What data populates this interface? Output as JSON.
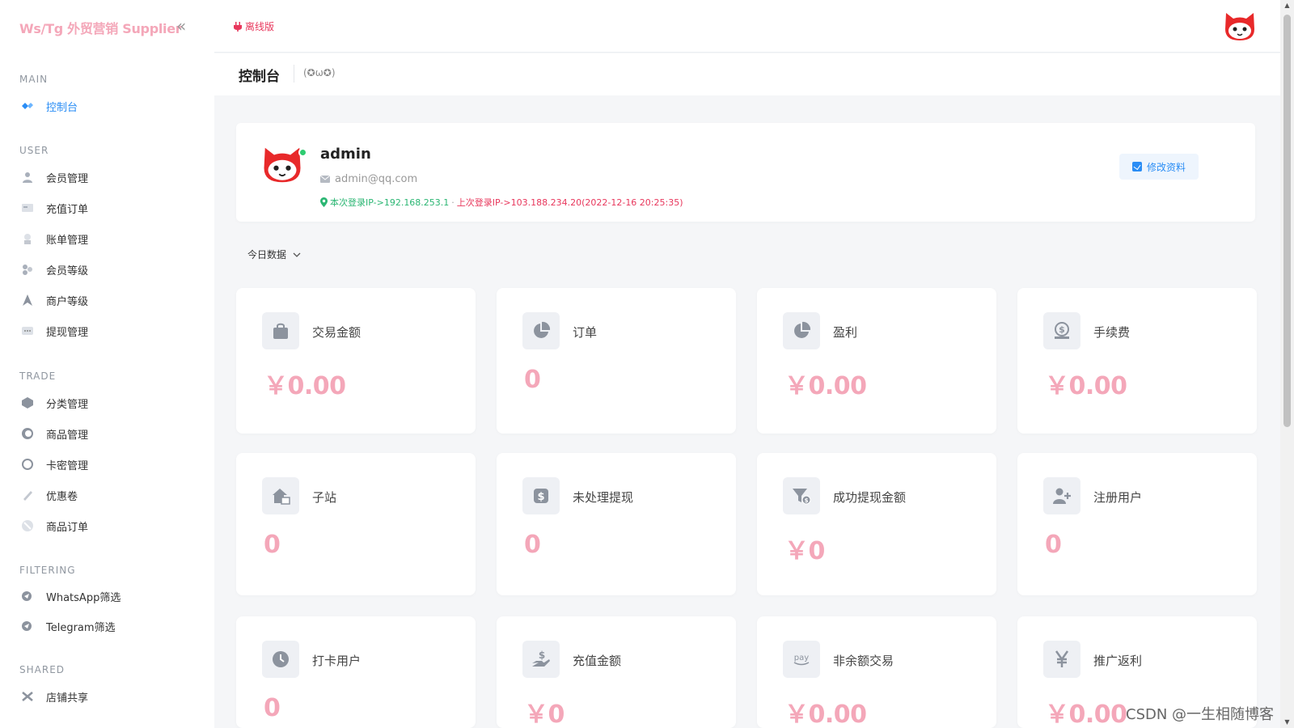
{
  "app": {
    "brand": "Ws/Tg 外贸营销 Supplier",
    "offline_label": "离线版"
  },
  "sidebar": {
    "sections": [
      {
        "title": "MAIN",
        "items": [
          {
            "label": "控制台",
            "icon": "dashboard-icon",
            "active": true
          }
        ]
      },
      {
        "title": "USER",
        "items": [
          {
            "label": "会员管理",
            "icon": "user-icon"
          },
          {
            "label": "充值订单",
            "icon": "recharge-order-icon"
          },
          {
            "label": "账单管理",
            "icon": "bill-icon"
          },
          {
            "label": "会员等级",
            "icon": "member-level-icon"
          },
          {
            "label": "商户等级",
            "icon": "merchant-level-icon"
          },
          {
            "label": "提现管理",
            "icon": "withdraw-icon"
          }
        ]
      },
      {
        "title": "TRADE",
        "items": [
          {
            "label": "分类管理",
            "icon": "category-icon"
          },
          {
            "label": "商品管理",
            "icon": "goods-icon"
          },
          {
            "label": "卡密管理",
            "icon": "card-key-icon"
          },
          {
            "label": "优惠卷",
            "icon": "coupon-icon"
          },
          {
            "label": "商品订单",
            "icon": "goods-order-icon"
          }
        ]
      },
      {
        "title": "FILTERING",
        "items": [
          {
            "label": "WhatsApp筛选",
            "icon": "whatsapp-icon"
          },
          {
            "label": "Telegram筛选",
            "icon": "telegram-icon"
          }
        ]
      },
      {
        "title": "SHARED",
        "items": [
          {
            "label": "店铺共享",
            "icon": "share-icon"
          }
        ]
      }
    ]
  },
  "header": {
    "page_title": "控制台",
    "emote": "(✪ω✪)"
  },
  "profile": {
    "username": "admin",
    "email": "admin@qq.com",
    "ip_current": "本次登录IP->192.168.253.1",
    "ip_separator": "·",
    "ip_last": "上次登录IP->103.188.234.20(2022-12-16 20:25:35)",
    "edit_label": "修改资料"
  },
  "period": {
    "selected": "今日数据"
  },
  "stats": [
    {
      "label": "交易金额",
      "value": "￥0.00",
      "icon": "shopping-bag-icon"
    },
    {
      "label": "订单",
      "value": "0",
      "icon": "pie-chart-icon"
    },
    {
      "label": "盈利",
      "value": "￥0.00",
      "icon": "pie-chart-icon"
    },
    {
      "label": "手续费",
      "value": "￥0.00",
      "icon": "money-bag-icon"
    },
    {
      "label": "子站",
      "value": "0",
      "icon": "house-icon"
    },
    {
      "label": "未处理提现",
      "value": "0",
      "icon": "dollar-square-icon"
    },
    {
      "label": "成功提现金额",
      "value": "￥0",
      "icon": "funnel-dollar-icon"
    },
    {
      "label": "注册用户",
      "value": "0",
      "icon": "user-plus-icon"
    },
    {
      "label": "打卡用户",
      "value": "0",
      "icon": "clock-icon"
    },
    {
      "label": "充值金额",
      "value": "￥0",
      "icon": "hand-dollar-icon"
    },
    {
      "label": "非余额交易",
      "value": "￥0.00",
      "icon": "pay-icon"
    },
    {
      "label": "推广返利",
      "value": "￥0.00",
      "icon": "yen-icon"
    }
  ],
  "watermark": "CSDN @一生相随博客"
}
